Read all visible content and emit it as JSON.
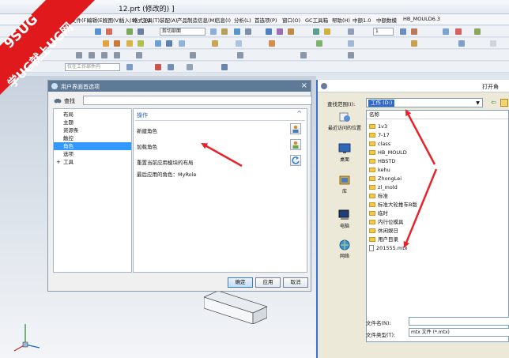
{
  "window": {
    "title": "12.prt (修改的) ]"
  },
  "menu": {
    "items": [
      "文件(F)",
      "编辑(E)",
      "视图(V)",
      "插入(S)",
      "格式(R)",
      "工具(T)",
      "装配(A)",
      "产品制造信息(M)",
      "信息(I)",
      "分析(L)",
      "首选项(P)",
      "窗口(O)",
      "GC工具箱",
      "帮助(H)",
      "中额1.0",
      "中额数模",
      "HB_MOULD6.3"
    ]
  },
  "toolbar": {
    "view_combo": "剪切部面",
    "layer_combo": "1",
    "filter_placeholder": "仅在工作部件内"
  },
  "banner": {
    "line1": "9SUG",
    "line2": "学UG就上UG网"
  },
  "pref_dialog": {
    "title": "用户界面首选项",
    "find_label": "查找",
    "tree": [
      {
        "label": "布局",
        "expandable": false,
        "selected": false
      },
      {
        "label": "主题",
        "expandable": false,
        "selected": false
      },
      {
        "label": "资源条",
        "expandable": false,
        "selected": false
      },
      {
        "label": "触控",
        "expandable": false,
        "selected": false
      },
      {
        "label": "角色",
        "expandable": false,
        "selected": true
      },
      {
        "label": "选项",
        "expandable": false,
        "selected": false
      },
      {
        "label": "工具",
        "expandable": true,
        "selected": false
      }
    ],
    "section_title": "操作",
    "actions": {
      "new_role": "新建角色",
      "load_role": "加载角色",
      "reset_layout": "重置当前应用模块的布局",
      "last_role": "最后应用的角色：MyRole"
    },
    "buttons": {
      "ok": "确定",
      "apply": "应用",
      "cancel": "取消"
    }
  },
  "open_dialog": {
    "title": "打开角",
    "lookin_label": "查找范围(I):",
    "lookin_value": "工作 (D:)",
    "places": [
      "最近访问的位置",
      "桌面",
      "库",
      "电脑",
      "网络"
    ],
    "column_name": "名称",
    "files": [
      {
        "name": "1v3",
        "type": "folder"
      },
      {
        "name": "7-17",
        "type": "folder"
      },
      {
        "name": "class",
        "type": "folder"
      },
      {
        "name": "HB_MOULD",
        "type": "folder"
      },
      {
        "name": "HBSTD",
        "type": "folder"
      },
      {
        "name": "kehu",
        "type": "folder"
      },
      {
        "name": "ZhongLei",
        "type": "folder"
      },
      {
        "name": "zl_mold",
        "type": "folder"
      },
      {
        "name": "标准",
        "type": "folder"
      },
      {
        "name": "标准大轮推车B版",
        "type": "folder"
      },
      {
        "name": "临时",
        "type": "folder"
      },
      {
        "name": "内行位模具",
        "type": "folder"
      },
      {
        "name": "休闲娱日",
        "type": "folder"
      },
      {
        "name": "用户目录",
        "type": "folder"
      },
      {
        "name": "201555.mtx",
        "type": "file"
      }
    ],
    "filename_label": "文件名(N):",
    "filename_value": "",
    "filetype_label": "文件类型(T):",
    "filetype_value": "mtx 文件 (*.mtx)"
  },
  "colors": {
    "banner": "#e0191c",
    "dialog_title": "#5f7a96",
    "selection": "#3399ff",
    "arrow": "#e8242a"
  }
}
